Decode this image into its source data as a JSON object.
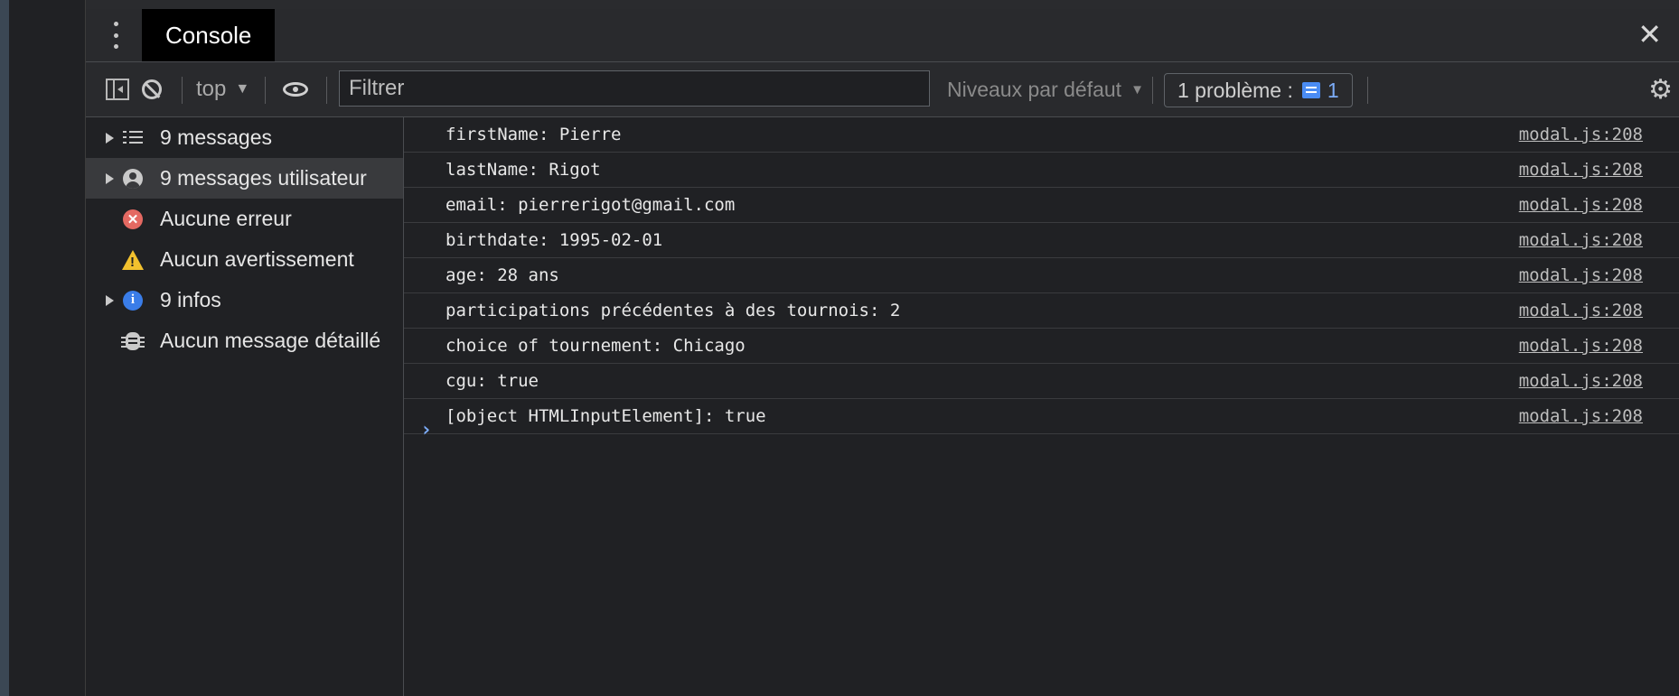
{
  "tabbar": {
    "tab_label": "Console",
    "close_glyph": "✕"
  },
  "toolbar": {
    "context": "top",
    "filter_placeholder": "Filtrer",
    "levels": "Niveaux par défaut",
    "issues_label": "1 problème :",
    "issues_count": "1"
  },
  "sidebar": {
    "items": [
      {
        "label": "9 messages",
        "icon": "list-icon"
      },
      {
        "label": "9 messages utilisateur",
        "icon": "user-icon"
      },
      {
        "label": "Aucune erreur",
        "icon": "error-icon"
      },
      {
        "label": "Aucun avertissement",
        "icon": "warning-icon"
      },
      {
        "label": "9 infos",
        "icon": "info-icon"
      },
      {
        "label": "Aucun message détaillé",
        "icon": "bug-icon"
      }
    ]
  },
  "console": {
    "messages": [
      {
        "text": "firstName: Pierre",
        "source": "modal.js:208"
      },
      {
        "text": "lastName: Rigot",
        "source": "modal.js:208"
      },
      {
        "text": "email: pierrerigot@gmail.com",
        "source": "modal.js:208"
      },
      {
        "text": "birthdate: 1995-02-01",
        "source": "modal.js:208"
      },
      {
        "text": "age: 28 ans",
        "source": "modal.js:208"
      },
      {
        "text": "participations précédentes à des tournois: 2",
        "source": "modal.js:208"
      },
      {
        "text": "choice of tournement: Chicago",
        "source": "modal.js:208"
      },
      {
        "text": "cgu: true",
        "source": "modal.js:208"
      },
      {
        "text": "[object HTMLInputElement]: true",
        "source": "modal.js:208"
      }
    ],
    "prompt_glyph": "›"
  },
  "colors": {
    "accent": "#7cacf8",
    "error": "#e46962",
    "warning": "#f2c12e",
    "info": "#3a7de8"
  }
}
